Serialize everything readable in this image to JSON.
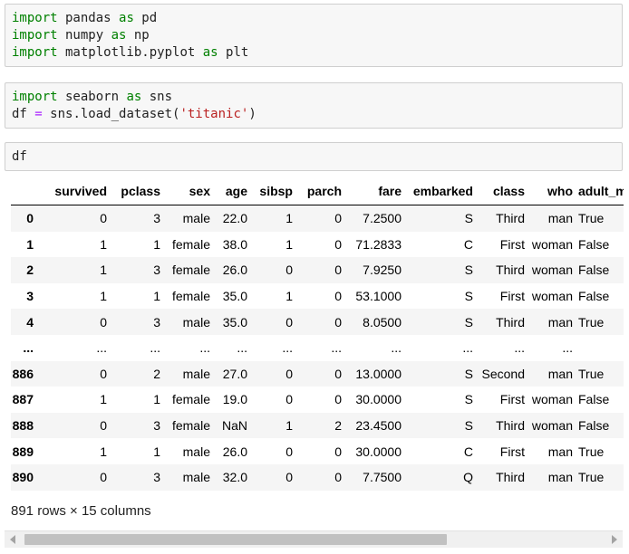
{
  "cells": [
    {
      "lines": [
        [
          {
            "t": "import",
            "c": "kw"
          },
          {
            "t": " pandas "
          },
          {
            "t": "as",
            "c": "kw"
          },
          {
            "t": " pd"
          }
        ],
        [
          {
            "t": "import",
            "c": "kw"
          },
          {
            "t": " numpy "
          },
          {
            "t": "as",
            "c": "kw"
          },
          {
            "t": " np"
          }
        ],
        [
          {
            "t": "import",
            "c": "kw"
          },
          {
            "t": " matplotlib.pyplot "
          },
          {
            "t": "as",
            "c": "kw"
          },
          {
            "t": " plt"
          }
        ]
      ]
    },
    {
      "lines": [
        [
          {
            "t": "import",
            "c": "kw"
          },
          {
            "t": " seaborn "
          },
          {
            "t": "as",
            "c": "kw"
          },
          {
            "t": " sns"
          }
        ],
        [
          {
            "t": "df "
          },
          {
            "t": "=",
            "c": "op"
          },
          {
            "t": " sns.load_dataset("
          },
          {
            "t": "'titanic'",
            "c": "str"
          },
          {
            "t": ")"
          }
        ]
      ]
    },
    {
      "lines": [
        [
          {
            "t": "df"
          }
        ]
      ]
    }
  ],
  "dataframe": {
    "columns": [
      "",
      "survived",
      "pclass",
      "sex",
      "age",
      "sibsp",
      "parch",
      "fare",
      "embarked",
      "class",
      "who",
      "adult_male"
    ],
    "rows": [
      [
        "0",
        "0",
        "3",
        "male",
        "22.0",
        "1",
        "0",
        "7.2500",
        "S",
        "Third",
        "man",
        "True"
      ],
      [
        "1",
        "1",
        "1",
        "female",
        "38.0",
        "1",
        "0",
        "71.2833",
        "C",
        "First",
        "woman",
        "False"
      ],
      [
        "2",
        "1",
        "3",
        "female",
        "26.0",
        "0",
        "0",
        "7.9250",
        "S",
        "Third",
        "woman",
        "False"
      ],
      [
        "3",
        "1",
        "1",
        "female",
        "35.0",
        "1",
        "0",
        "53.1000",
        "S",
        "First",
        "woman",
        "False"
      ],
      [
        "4",
        "0",
        "3",
        "male",
        "35.0",
        "0",
        "0",
        "8.0500",
        "S",
        "Third",
        "man",
        "True"
      ],
      [
        "...",
        "...",
        "...",
        "...",
        "...",
        "...",
        "...",
        "...",
        "...",
        "...",
        "...",
        ""
      ],
      [
        "886",
        "0",
        "2",
        "male",
        "27.0",
        "0",
        "0",
        "13.0000",
        "S",
        "Second",
        "man",
        "True"
      ],
      [
        "887",
        "1",
        "1",
        "female",
        "19.0",
        "0",
        "0",
        "30.0000",
        "S",
        "First",
        "woman",
        "False"
      ],
      [
        "888",
        "0",
        "3",
        "female",
        "NaN",
        "1",
        "2",
        "23.4500",
        "S",
        "Third",
        "woman",
        "False"
      ],
      [
        "889",
        "1",
        "1",
        "male",
        "26.0",
        "0",
        "0",
        "30.0000",
        "C",
        "First",
        "man",
        "True"
      ],
      [
        "890",
        "0",
        "3",
        "male",
        "32.0",
        "0",
        "0",
        "7.7500",
        "Q",
        "Third",
        "man",
        "True"
      ]
    ]
  },
  "shape_text": "891 rows × 15 columns"
}
